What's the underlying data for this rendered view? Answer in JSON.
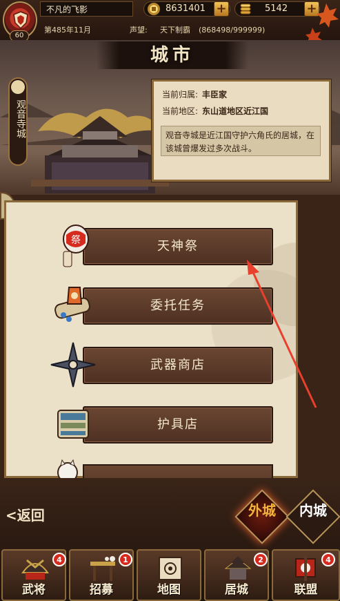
{
  "player": {
    "name": "不凡的飞影",
    "level": "60",
    "date": "第485年11月",
    "reputation_label": "声望:",
    "reputation_title": "天下制霸",
    "reputation_value": "(868498/999999)"
  },
  "resources": {
    "coins": "8631401",
    "gold": "5142",
    "add_icon": "plus-icon"
  },
  "scene": {
    "title": "城市",
    "city_name": "观音寺城"
  },
  "info": {
    "owner_label": "当前归属:",
    "owner_value": "丰臣家",
    "region_label": "当前地区:",
    "region_value": "东山道地区近江国",
    "description": "观音寺城是近江国守护六角氏的居城，在该城曾爆发过多次战斗。"
  },
  "menu": {
    "items": [
      {
        "label": "天神祭",
        "icon": "festival-lantern-icon"
      },
      {
        "label": "委托任务",
        "icon": "scroll-task-icon"
      },
      {
        "label": "武器商店",
        "icon": "shuriken-icon"
      },
      {
        "label": "护具店",
        "icon": "armor-icon"
      }
    ]
  },
  "nav": {
    "back": "返回",
    "outer_city": "外城",
    "inner_city": "内城"
  },
  "tabs": [
    {
      "label": "武将",
      "badge": "4"
    },
    {
      "label": "招募",
      "badge": "1"
    },
    {
      "label": "地图",
      "badge": ""
    },
    {
      "label": "居城",
      "badge": "2"
    },
    {
      "label": "联盟",
      "badge": "4"
    }
  ],
  "colors": {
    "accent_red": "#d62a1e",
    "panel_bg": "#ebe0c8",
    "wood": "#5a3a28",
    "arrow": "#e8402c"
  }
}
